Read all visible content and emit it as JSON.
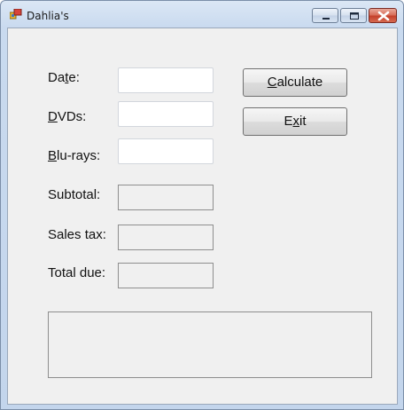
{
  "window": {
    "title": "Dahlia's"
  },
  "form": {
    "date": {
      "access_key": "t",
      "label_before": "Da",
      "label_after": "e:",
      "value": ""
    },
    "dvds": {
      "access_key": "D",
      "label_after": "VDs:",
      "value": ""
    },
    "blurays": {
      "access_key": "B",
      "label_after": "lu-rays:",
      "value": ""
    },
    "subtotal": {
      "label": "Subtotal:",
      "value": ""
    },
    "sales_tax": {
      "label": "Sales tax:",
      "value": ""
    },
    "total_due": {
      "label": "Total due:",
      "value": ""
    }
  },
  "buttons": {
    "calculate": {
      "access_key": "C",
      "label_after": "alculate"
    },
    "exit": {
      "label_before": "E",
      "access_key": "x",
      "label_after": "it"
    }
  },
  "output": {
    "text": ""
  },
  "icons": {
    "app": "app-icon",
    "minimize": "minimize-icon",
    "maximize": "maximize-icon",
    "close": "close-icon"
  },
  "colors": {
    "titlebar": "#c9daef",
    "client_background": "#f0f0f0",
    "close_button": "#c4412b"
  }
}
